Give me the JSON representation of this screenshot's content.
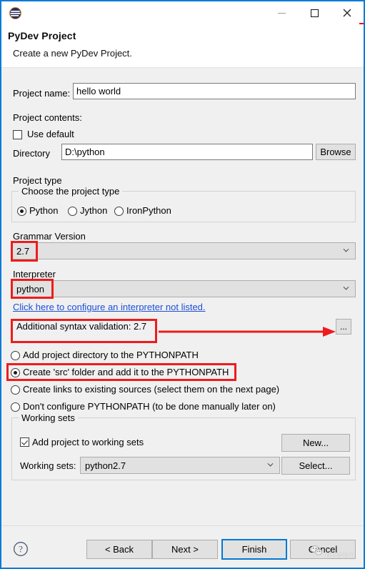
{
  "window": {
    "icon": "eclipse-icon",
    "minimize_label": "Minimize",
    "maximize_label": "Maximize",
    "close_label": "Close"
  },
  "header": {
    "title": "PyDev Project",
    "subtitle": "Create a new PyDev Project."
  },
  "form": {
    "project_name_label": "Project name:",
    "project_name_value": "hello world",
    "project_contents_label": "Project contents:",
    "use_default_label": "Use default",
    "use_default_checked": false,
    "directory_label": "Directory",
    "directory_value": "D:\\python",
    "browse_label": "Browse"
  },
  "project_type": {
    "section_label": "Project type",
    "group_title": "Choose the project type",
    "options": [
      {
        "label": "Python",
        "selected": true
      },
      {
        "label": "Jython",
        "selected": false
      },
      {
        "label": "IronPython",
        "selected": false
      }
    ]
  },
  "grammar": {
    "label": "Grammar Version",
    "value": "2.7"
  },
  "interpreter": {
    "label": "Interpreter",
    "value": "python",
    "config_link": "Click here to configure an interpreter not listed."
  },
  "syntax_validation": {
    "label": "Additional syntax validation: 2.7",
    "more_button_label": "..."
  },
  "pythonpath": {
    "options": [
      {
        "label": "Add project directory to the PYTHONPATH",
        "selected": false
      },
      {
        "label": "Create 'src' folder and add it to the PYTHONPATH",
        "selected": true
      },
      {
        "label": "Create links to existing sources (select them on the next page)",
        "selected": false
      },
      {
        "label": "Don't configure PYTHONPATH (to be done manually later on)",
        "selected": false
      }
    ]
  },
  "working_sets": {
    "group_title": "Working sets",
    "add_checkbox_label": "Add project to working sets",
    "add_checkbox_checked": true,
    "new_button_label": "New...",
    "select_label": "Working sets:",
    "select_value": "python2.7",
    "select_button_label": "Select..."
  },
  "footer": {
    "help_label": "?",
    "back_label": "< Back",
    "next_label": "Next >",
    "finish_label": "Finish",
    "cancel_label": "Cancel"
  },
  "watermark": {
    "text": "ezwen"
  },
  "annotations": {
    "accent_color": "#ee1c1c",
    "boxes": [
      {
        "name": "grammar-version-highlight"
      },
      {
        "name": "interpreter-highlight"
      },
      {
        "name": "syntax-validation-highlight"
      },
      {
        "name": "src-folder-highlight"
      }
    ]
  },
  "colors": {
    "window_border": "#0a7ad6",
    "dialog_background": "#f0f0f0",
    "default_button_border": "#0078d7",
    "link": "#1c4fd8"
  }
}
